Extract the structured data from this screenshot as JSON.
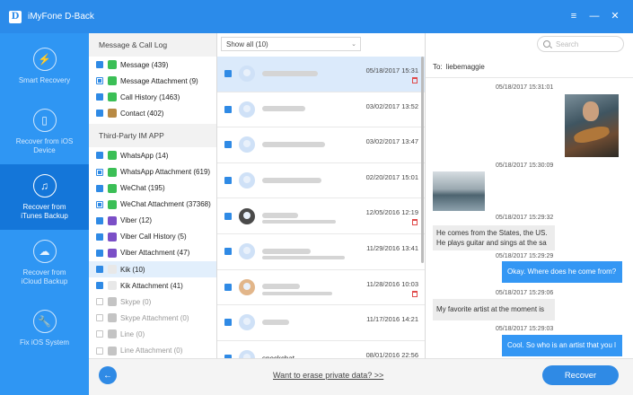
{
  "app": {
    "title": "iMyFone D-Back",
    "logo_letter": "D"
  },
  "window": {
    "menu": "≡",
    "minimize": "—",
    "close": "✕"
  },
  "sidebar": {
    "items": [
      {
        "label": "Smart Recovery",
        "icon": "⚡",
        "active": false
      },
      {
        "label": "Recover from iOS Device",
        "icon": "▯",
        "active": false
      },
      {
        "label": "Recover from iTunes Backup",
        "icon": "♫",
        "active": true
      },
      {
        "label": "Recover from iCloud Backup",
        "icon": "☁",
        "active": false
      },
      {
        "label": "Fix iOS System",
        "icon": "🔧",
        "active": false
      }
    ]
  },
  "categories": {
    "section1_title": "Message & Call Log",
    "section1": [
      {
        "label": "Message (439)",
        "state": "checked",
        "icon": "ic-green"
      },
      {
        "label": "Message Attachment (9)",
        "state": "partial",
        "icon": "ic-green"
      },
      {
        "label": "Call History (1463)",
        "state": "checked",
        "icon": "ic-green"
      },
      {
        "label": "Contact (402)",
        "state": "checked",
        "icon": "ic-brown"
      }
    ],
    "section2_title": "Third-Party IM APP",
    "section2": [
      {
        "label": "WhatsApp (14)",
        "state": "checked",
        "icon": "ic-green"
      },
      {
        "label": "WhatsApp Attachment (619)",
        "state": "partial",
        "icon": "ic-green"
      },
      {
        "label": "WeChat (195)",
        "state": "checked",
        "icon": "ic-green"
      },
      {
        "label": "WeChat Attachment (37368)",
        "state": "partial",
        "icon": "ic-green"
      },
      {
        "label": "Viber (12)",
        "state": "checked",
        "icon": "ic-purple"
      },
      {
        "label": "Viber Call History (5)",
        "state": "checked",
        "icon": "ic-purple"
      },
      {
        "label": "Viber Attachment (47)",
        "state": "checked",
        "icon": "ic-purple"
      },
      {
        "label": "Kik (10)",
        "state": "checked",
        "icon": "ic-kik",
        "selected": true
      },
      {
        "label": "Kik Attachment (41)",
        "state": "checked",
        "icon": "ic-kik"
      },
      {
        "label": "Skype (0)",
        "state": "off",
        "icon": "ic-grey",
        "dim": true
      },
      {
        "label": "Skype Attachment (0)",
        "state": "off",
        "icon": "ic-grey",
        "dim": true
      },
      {
        "label": "Line (0)",
        "state": "off",
        "icon": "ic-grey",
        "dim": true
      },
      {
        "label": "Line Attachment (0)",
        "state": "off",
        "icon": "ic-grey",
        "dim": true
      }
    ]
  },
  "list": {
    "filter": "Show all (10)",
    "rows": [
      {
        "date": "05/18/2017 15:31",
        "trash": true,
        "selected": true,
        "avatar": "default"
      },
      {
        "date": "03/02/2017 13:52",
        "trash": false,
        "selected": false,
        "avatar": "default"
      },
      {
        "date": "03/02/2017 13:47",
        "trash": false,
        "selected": false,
        "avatar": "default"
      },
      {
        "date": "02/20/2017 15:01",
        "trash": false,
        "selected": false,
        "avatar": "default"
      },
      {
        "date": "12/05/2016 12:19",
        "trash": true,
        "selected": false,
        "avatar": "photo1"
      },
      {
        "date": "11/29/2016 13:41",
        "trash": false,
        "selected": false,
        "avatar": "default"
      },
      {
        "date": "11/28/2016 10:03",
        "trash": true,
        "selected": false,
        "avatar": "photo2"
      },
      {
        "date": "11/17/2016 14:21",
        "trash": false,
        "selected": false,
        "avatar": "default"
      },
      {
        "name": "snockchat",
        "date": "08/01/2016 22:56",
        "trash": false,
        "selected": false,
        "avatar": "default"
      }
    ]
  },
  "detail": {
    "search_placeholder": "Search",
    "to_label": "To:",
    "to_name": "liebemaggie",
    "messages": [
      {
        "time": "05/18/2017 15:31:01"
      },
      {
        "time": "05/18/2017 15:30:09"
      },
      {
        "time": "05/18/2017 15:29:32",
        "text1": "He comes from the States, the US.",
        "text2": "He plays guitar and sings at the sa"
      },
      {
        "time": "05/18/2017 15:29:29",
        "text": "Okay. Where does he come from?"
      },
      {
        "time": "05/18/2017 15:29:06",
        "text": "My favorite artist at the moment is"
      },
      {
        "time": "05/18/2017 15:29:03",
        "text": "Cool. So who is an artist that you l"
      }
    ]
  },
  "footer": {
    "back": "←",
    "erase_link": "Want to erase private data? >>",
    "recover": "Recover"
  }
}
